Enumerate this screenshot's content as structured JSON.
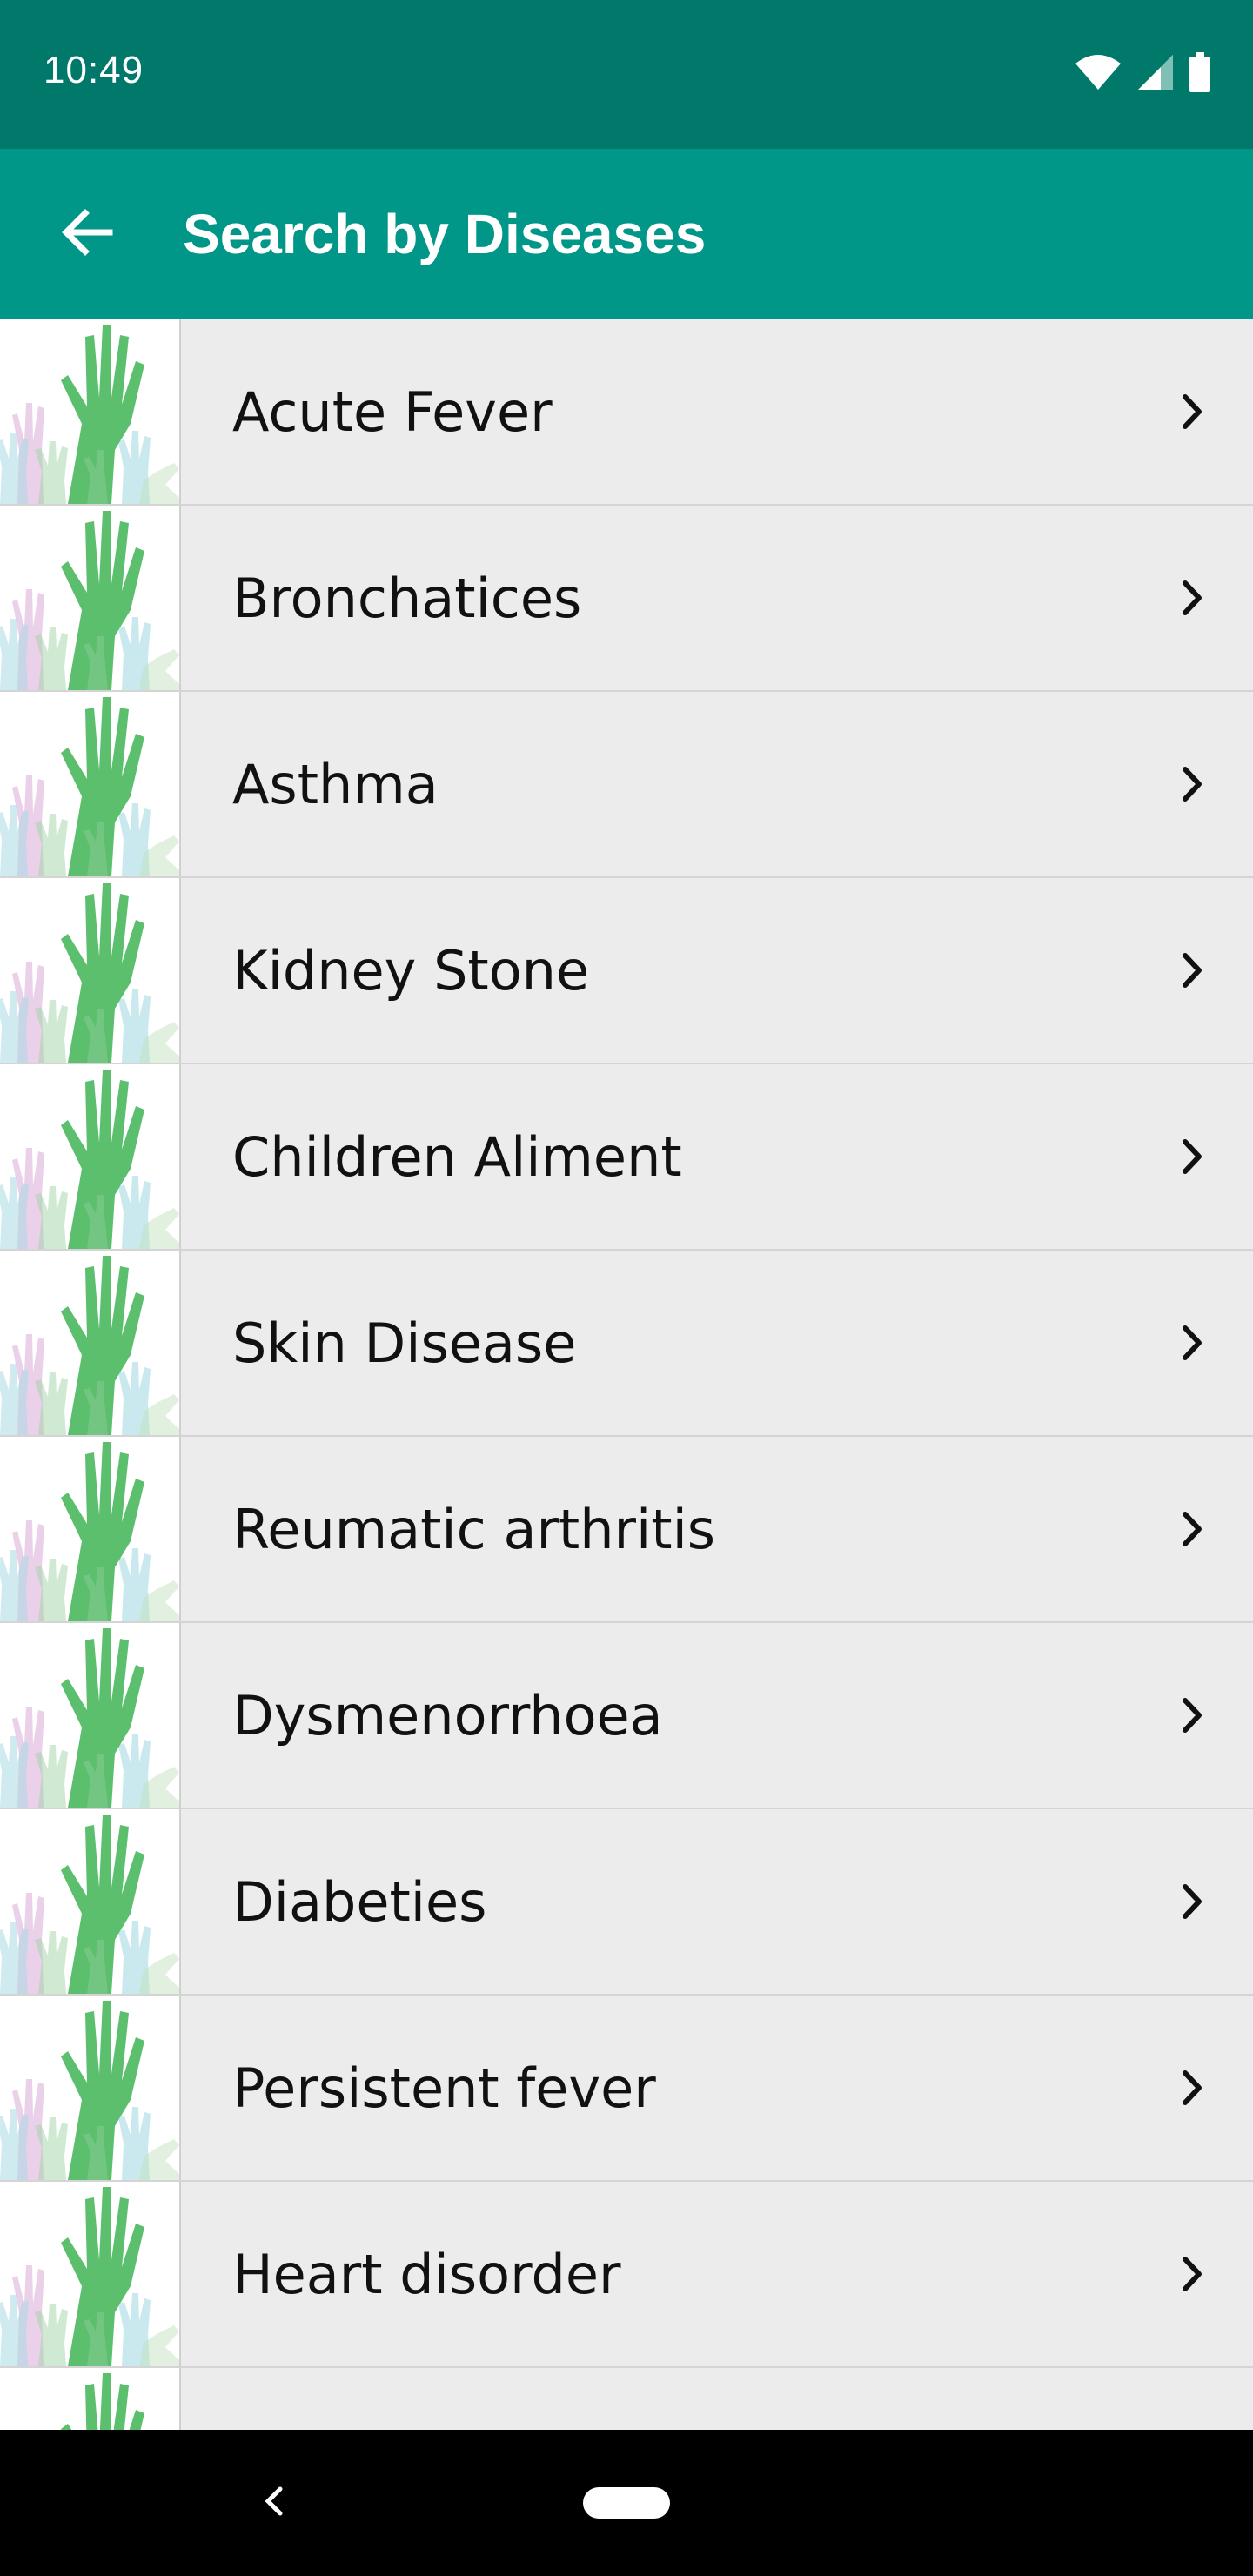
{
  "status_bar": {
    "time": "10:49",
    "icons": [
      "wifi-icon",
      "signal-icon",
      "battery-icon"
    ]
  },
  "app_bar": {
    "title": "Search by Diseases",
    "back_icon": "arrow-left-icon"
  },
  "colors": {
    "status_bar": "#00796b",
    "app_bar": "#009688",
    "list_background": "#ececec",
    "hand_green": "#5cbf6e"
  },
  "diseases": [
    {
      "label": "Acute Fever"
    },
    {
      "label": "Bronchatices"
    },
    {
      "label": "Asthma"
    },
    {
      "label": "Kidney Stone"
    },
    {
      "label": "Children Aliment"
    },
    {
      "label": "Skin Disease"
    },
    {
      "label": "Reumatic arthritis"
    },
    {
      "label": "Dysmenorrhoea"
    },
    {
      "label": "Diabeties"
    },
    {
      "label": "Persistent fever"
    },
    {
      "label": "Heart disorder"
    },
    {
      "label": ""
    }
  ],
  "nav_bar": {
    "back_icon": "nav-back-icon",
    "home_icon": "home-pill-icon"
  }
}
